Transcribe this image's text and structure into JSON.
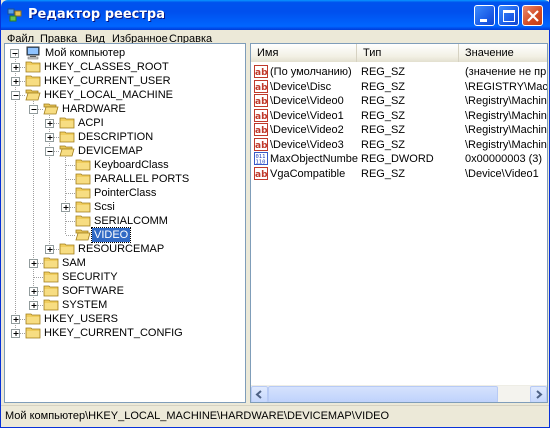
{
  "window": {
    "title": "Редактор реестра"
  },
  "menu": [
    {
      "label": "Файл",
      "accel": "Ф",
      "rest": "айл"
    },
    {
      "label": "Правка",
      "accel": "П",
      "rest": "равка"
    },
    {
      "label": "Вид",
      "accel": "В",
      "rest": "ид"
    },
    {
      "label": "Избранное",
      "accel": "И",
      "rest": "збранное"
    },
    {
      "label": "Справка",
      "accel": "С",
      "rest": "правка"
    }
  ],
  "tree": {
    "root": "Мой компьютер",
    "nodes": [
      {
        "label": "HKEY_CLASSES_ROOT",
        "state": "collapsed"
      },
      {
        "label": "HKEY_CURRENT_USER",
        "state": "collapsed"
      },
      {
        "label": "HKEY_LOCAL_MACHINE",
        "state": "expanded"
      },
      {
        "label": "HARDWARE",
        "state": "expanded"
      },
      {
        "label": "ACPI",
        "state": "collapsed"
      },
      {
        "label": "DESCRIPTION",
        "state": "collapsed"
      },
      {
        "label": "DEVICEMAP",
        "state": "expanded"
      },
      {
        "label": "KeyboardClass",
        "state": "leaf"
      },
      {
        "label": "PARALLEL PORTS",
        "state": "leaf"
      },
      {
        "label": "PointerClass",
        "state": "leaf"
      },
      {
        "label": "Scsi",
        "state": "collapsed"
      },
      {
        "label": "SERIALCOMM",
        "state": "leaf"
      },
      {
        "label": "VIDEO",
        "state": "selected"
      },
      {
        "label": "RESOURCEMAP",
        "state": "collapsed"
      },
      {
        "label": "SAM",
        "state": "collapsed"
      },
      {
        "label": "SECURITY",
        "state": "leaf"
      },
      {
        "label": "SOFTWARE",
        "state": "collapsed"
      },
      {
        "label": "SYSTEM",
        "state": "collapsed"
      },
      {
        "label": "HKEY_USERS",
        "state": "collapsed"
      },
      {
        "label": "HKEY_CURRENT_CONFIG",
        "state": "collapsed"
      }
    ]
  },
  "list": {
    "columns": [
      "Имя",
      "Тип",
      "Значение"
    ],
    "rows": [
      {
        "icon": "string-value-icon",
        "name": "(По умолчанию)",
        "type": "REG_SZ",
        "value": "(значение не присвоено)"
      },
      {
        "icon": "string-value-icon",
        "name": "\\Device\\Disc",
        "type": "REG_SZ",
        "value": "\\REGISTRY\\Machine\\System"
      },
      {
        "icon": "string-value-icon",
        "name": "\\Device\\Video0",
        "type": "REG_SZ",
        "value": "\\Registry\\Machine\\System"
      },
      {
        "icon": "string-value-icon",
        "name": "\\Device\\Video1",
        "type": "REG_SZ",
        "value": "\\Registry\\Machine\\System"
      },
      {
        "icon": "string-value-icon",
        "name": "\\Device\\Video2",
        "type": "REG_SZ",
        "value": "\\Registry\\Machine\\System"
      },
      {
        "icon": "string-value-icon",
        "name": "\\Device\\Video3",
        "type": "REG_SZ",
        "value": "\\Registry\\Machine\\System"
      },
      {
        "icon": "dword-value-icon",
        "name": "MaxObjectNumber",
        "type": "REG_DWORD",
        "value": "0x00000003 (3)"
      },
      {
        "icon": "string-value-icon",
        "name": "VgaCompatible",
        "type": "REG_SZ",
        "value": "\\Device\\Video1"
      }
    ]
  },
  "status": {
    "path": "Мой компьютер\\HKEY_LOCAL_MACHINE\\HARDWARE\\DEVICEMAP\\VIDEO"
  }
}
